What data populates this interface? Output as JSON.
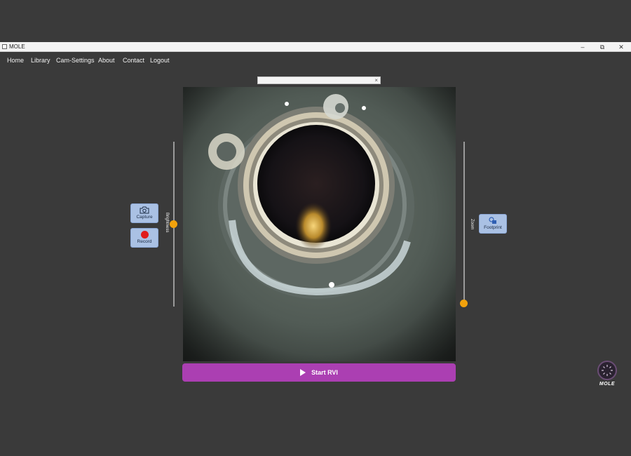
{
  "window": {
    "title": "MOLE",
    "controls": {
      "minimize": "–",
      "maximize": "⧉",
      "close": "✕"
    }
  },
  "menu": {
    "items": [
      {
        "label": "Home"
      },
      {
        "label": "Library"
      },
      {
        "label": "Cam-Settings"
      },
      {
        "label": "About"
      },
      {
        "label": "Contact"
      },
      {
        "label": "Logout"
      }
    ]
  },
  "url_field": {
    "value": "",
    "clear_icon": "×"
  },
  "left_controls": {
    "capture_label": "Capture",
    "record_label": "Record",
    "brightness_label": "Brightness",
    "brightness_level": 0.5
  },
  "right_controls": {
    "footprint_label": "Footprint",
    "zoom_label": "Zoom",
    "zoom_level": 0.0
  },
  "start_button": {
    "label": "Start RVI"
  },
  "logo": {
    "text": "MOLE"
  },
  "colors": {
    "background": "#3a3a3a",
    "accent_purple": "#ab3fb2",
    "slider_thumb": "#f2a20c",
    "button_blue": "#aac1e4",
    "record_red": "#e01b1b"
  }
}
